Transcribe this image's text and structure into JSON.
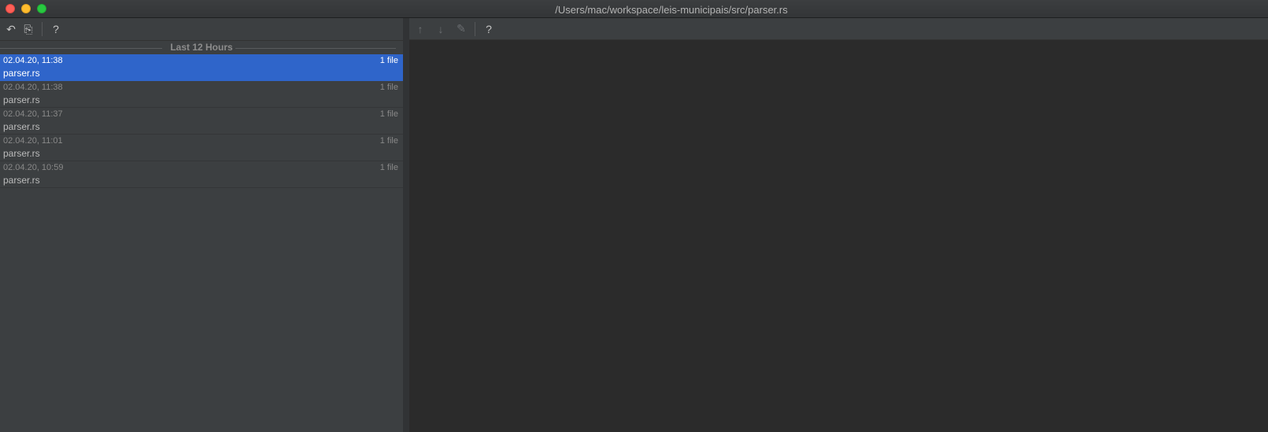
{
  "window": {
    "title": "/Users/mac/workspace/leis-municipais/src/parser.rs"
  },
  "left_toolbar": {
    "revert_icon": "↶",
    "diff_icon": "⎘",
    "help_label": "?"
  },
  "history": {
    "group_label": "Last 12 Hours",
    "items": [
      {
        "time": "02.04.20, 11:38",
        "count": "1 file",
        "file": "parser.rs",
        "selected": true
      },
      {
        "time": "02.04.20, 11:38",
        "count": "1 file",
        "file": "parser.rs",
        "selected": false
      },
      {
        "time": "02.04.20, 11:37",
        "count": "1 file",
        "file": "parser.rs",
        "selected": false
      },
      {
        "time": "02.04.20, 11:01",
        "count": "1 file",
        "file": "parser.rs",
        "selected": false
      },
      {
        "time": "02.04.20, 10:59",
        "count": "1 file",
        "file": "parser.rs",
        "selected": false
      }
    ]
  },
  "right_toolbar": {
    "up_icon": "↑",
    "down_icon": "↓",
    "edit_icon": "✎",
    "help_label": "?"
  },
  "colors": {
    "selection": "#2f65ca",
    "panel": "#3c3f41",
    "editor": "#2b2b2b"
  }
}
